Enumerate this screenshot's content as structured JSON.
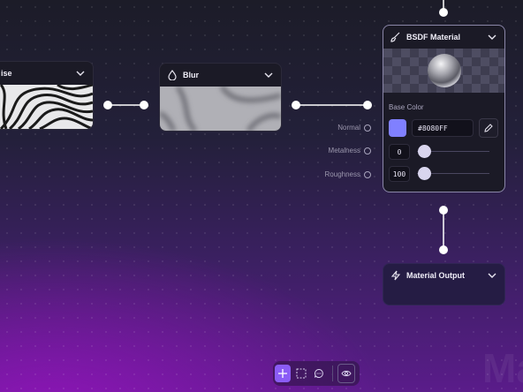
{
  "nodes": {
    "noise": {
      "title": "ise"
    },
    "blur": {
      "title": "Blur"
    },
    "bsdf": {
      "title": "BSDF Material",
      "inputs": [
        "Normal",
        "Metalness",
        "Roughness"
      ],
      "base_color_label": "Base Color",
      "base_color_hex": "#8080FF",
      "metalness_value": "0",
      "metalness_level": 0,
      "roughness_value": "100",
      "roughness_level": 0
    },
    "output": {
      "title": "Material Output"
    }
  },
  "toolbar": {
    "tools": [
      "add-icon",
      "select-rect-icon",
      "comment-icon",
      "preview-eye-icon"
    ]
  },
  "watermark": "Ma",
  "colors": {
    "accent": "#8b5cf6",
    "swatch": "#8080FF"
  }
}
